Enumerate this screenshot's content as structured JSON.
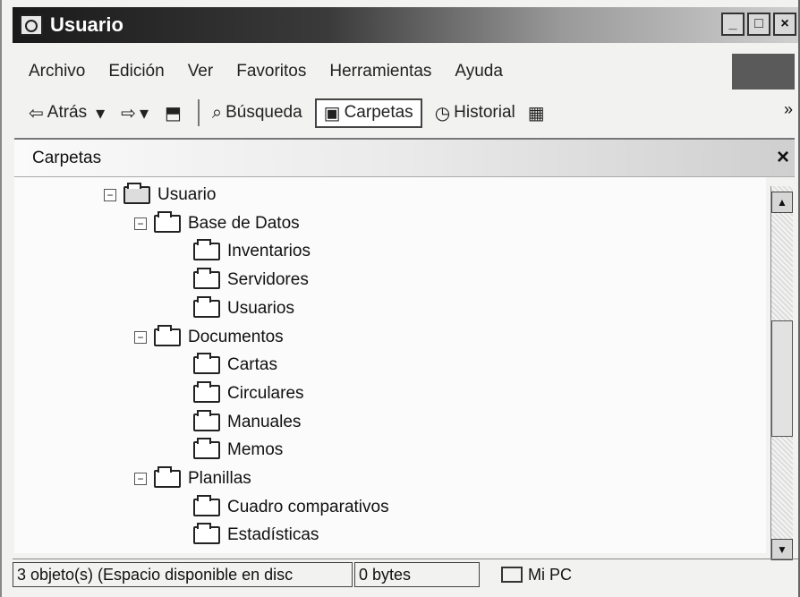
{
  "window": {
    "title": "Usuario",
    "buttons": [
      "_",
      "□",
      "×"
    ]
  },
  "menu": {
    "items": [
      "Archivo",
      "Edición",
      "Ver",
      "Favoritos",
      "Herramientas",
      "Ayuda"
    ]
  },
  "toolbar": {
    "back_label": "Atrás",
    "search_label": "Búsqueda",
    "folders_label": "Carpetas",
    "history_label": "Historial",
    "more": "»"
  },
  "pane": {
    "title": "Carpetas",
    "close": "×"
  },
  "tree": [
    {
      "label": "Usuario",
      "level": 0,
      "expander": "−",
      "open": true
    },
    {
      "label": "Base de Datos",
      "level": 1,
      "expander": "−",
      "open": false
    },
    {
      "label": "Inventarios",
      "level": 2,
      "expander": "",
      "open": false
    },
    {
      "label": "Servidores",
      "level": 2,
      "expander": "",
      "open": false
    },
    {
      "label": "Usuarios",
      "level": 2,
      "expander": "",
      "open": false
    },
    {
      "label": "Documentos",
      "level": 1,
      "expander": "−",
      "open": false
    },
    {
      "label": "Cartas",
      "level": 2,
      "expander": "",
      "open": false
    },
    {
      "label": "Circulares",
      "level": 2,
      "expander": "",
      "open": false
    },
    {
      "label": "Manuales",
      "level": 2,
      "expander": "",
      "open": false
    },
    {
      "label": "Memos",
      "level": 2,
      "expander": "",
      "open": false
    },
    {
      "label": "Planillas",
      "level": 1,
      "expander": "−",
      "open": false
    },
    {
      "label": "Cuadro comparativos",
      "level": 2,
      "expander": "",
      "open": false
    },
    {
      "label": "Estadísticas",
      "level": 2,
      "expander": "",
      "open": false
    }
  ],
  "status": {
    "message": "3 objeto(s) (Espacio disponible en disc",
    "size": "0 bytes",
    "zone": "Mi PC"
  }
}
